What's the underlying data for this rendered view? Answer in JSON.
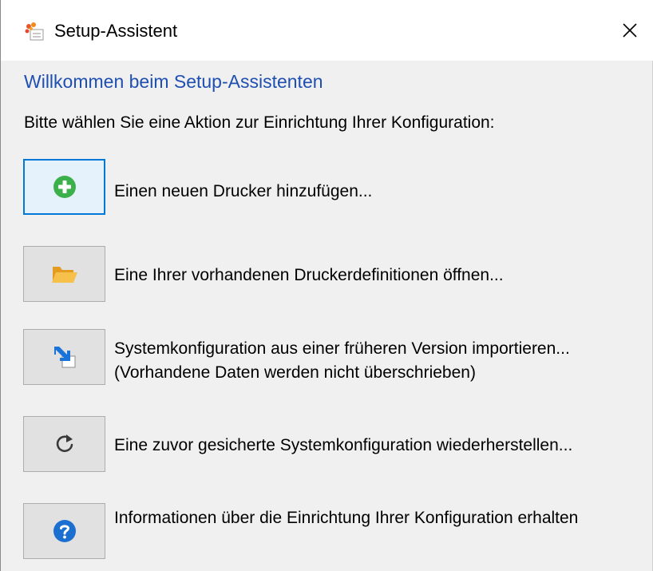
{
  "window": {
    "title": "Setup-Assistent",
    "close_label": "Close"
  },
  "main": {
    "heading": "Willkommen beim Setup-Assistenten",
    "prompt": "Bitte wählen Sie eine Aktion zur Einrichtung Ihrer Konfiguration:",
    "actions": [
      {
        "icon": "add-icon",
        "label": "Einen neuen Drucker hinzufügen..."
      },
      {
        "icon": "folder-open-icon",
        "label": "Eine Ihrer vorhandenen Druckerdefinitionen öffnen..."
      },
      {
        "icon": "import-icon",
        "label": "Systemkonfiguration aus einer früheren Version importieren...",
        "label2": "(Vorhandene Daten werden nicht überschrieben)"
      },
      {
        "icon": "restore-icon",
        "label": "Eine zuvor gesicherte Systemkonfiguration wiederherstellen..."
      },
      {
        "icon": "help-icon",
        "label": "Informationen über die Einrichtung Ihrer Konfiguration erhalten"
      }
    ]
  },
  "colors": {
    "heading": "#1f4fb0",
    "add_icon": "#3cb04a",
    "folder_icon": "#f5b335",
    "import_arrow": "#1a73d9",
    "help_icon": "#1a6fd0",
    "focus_border": "#0078d7"
  }
}
